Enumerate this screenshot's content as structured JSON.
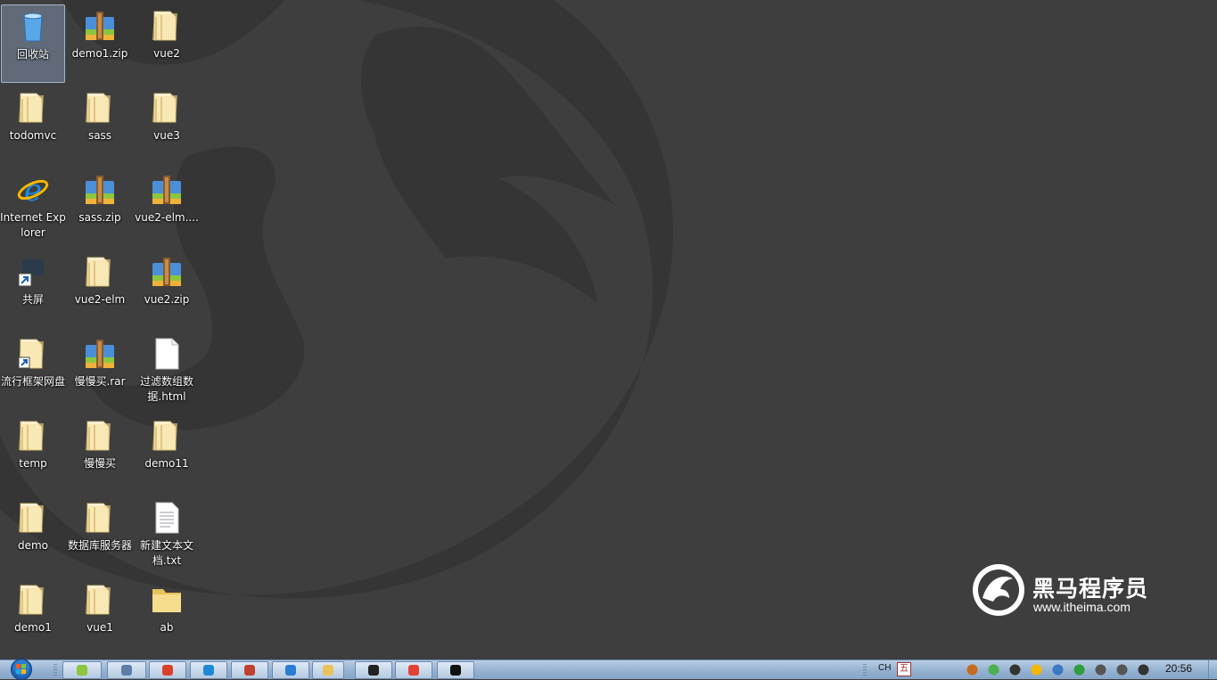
{
  "desktop": {
    "icons": [
      {
        "label": "回收站",
        "type": "recycle"
      },
      {
        "label": "todomvc",
        "type": "folder"
      },
      {
        "label": "Internet Explorer",
        "type": "ie"
      },
      {
        "label": "共屏",
        "type": "shortcut"
      },
      {
        "label": "流行框架网盘",
        "type": "folder-shortcut"
      },
      {
        "label": "temp",
        "type": "folder"
      },
      {
        "label": "demo",
        "type": "folder"
      },
      {
        "label": "demo1",
        "type": "folder"
      },
      {
        "label": "demo1.zip",
        "type": "zip"
      },
      {
        "label": "sass",
        "type": "folder"
      },
      {
        "label": "sass.zip",
        "type": "zip"
      },
      {
        "label": "vue2-elm",
        "type": "folder"
      },
      {
        "label": "慢慢买.rar",
        "type": "zip"
      },
      {
        "label": "慢慢买",
        "type": "folder"
      },
      {
        "label": "数据库服务器",
        "type": "folder"
      },
      {
        "label": "vue1",
        "type": "folder"
      },
      {
        "label": "vue2",
        "type": "folder"
      },
      {
        "label": "vue3",
        "type": "folder"
      },
      {
        "label": "vue2-elm....",
        "type": "zip"
      },
      {
        "label": "vue2.zip",
        "type": "zip"
      },
      {
        "label": "过滤数组数据.html",
        "type": "file"
      },
      {
        "label": "demo11",
        "type": "folder"
      },
      {
        "label": "新建文本文档.txt",
        "type": "txt"
      },
      {
        "label": "ab",
        "type": "folder-plain"
      }
    ]
  },
  "brand": {
    "name": "黑马程序员",
    "url": "www.itheima.com"
  },
  "taskbar": {
    "pinned": [
      "ie-360-icon",
      "recycle-app-icon",
      "office-icon",
      "refresh-app-icon",
      "paint-app-icon",
      "vscode-icon",
      "explorer-icon",
      "media-icon",
      "chrome-icon",
      "cmd-icon"
    ],
    "tray": {
      "lang": "CH",
      "ime": "五",
      "clock": "20:56"
    }
  },
  "colors": {
    "wallpaper": "#3e3e3e",
    "logo": "#353535",
    "folder": "#f3d98a"
  }
}
